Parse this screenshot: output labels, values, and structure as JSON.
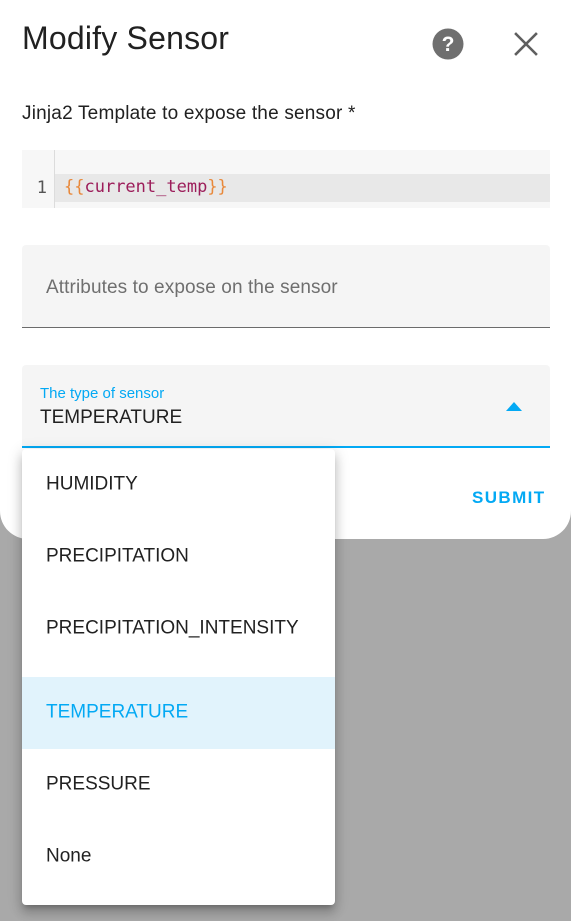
{
  "dialog": {
    "title": "Modify Sensor",
    "template_label": "Jinja2 Template to expose the sensor *",
    "code": {
      "line_number": "1",
      "open_brace": "{{",
      "variable": "current_temp",
      "close_brace": "}}"
    },
    "attributes_placeholder": "Attributes to expose on the sensor",
    "type_select": {
      "label": "The type of sensor",
      "value": "TEMPERATURE"
    },
    "submit_label": "SUBMIT"
  },
  "dropdown": {
    "items": [
      {
        "label": "HUMIDITY"
      },
      {
        "label": "PRECIPITATION"
      },
      {
        "label": "PRECIPITATION_INTENSITY"
      },
      {
        "label": "TEMPERATURE"
      },
      {
        "label": "PRESSURE"
      },
      {
        "label": "None"
      }
    ]
  },
  "colors": {
    "accent": "#03a9f4",
    "selected_bg": "#e1f3fc",
    "backdrop": "#a9a9a9"
  },
  "icons": {
    "help": "help-circle-icon",
    "close": "close-icon",
    "caret": "caret-up-icon"
  }
}
